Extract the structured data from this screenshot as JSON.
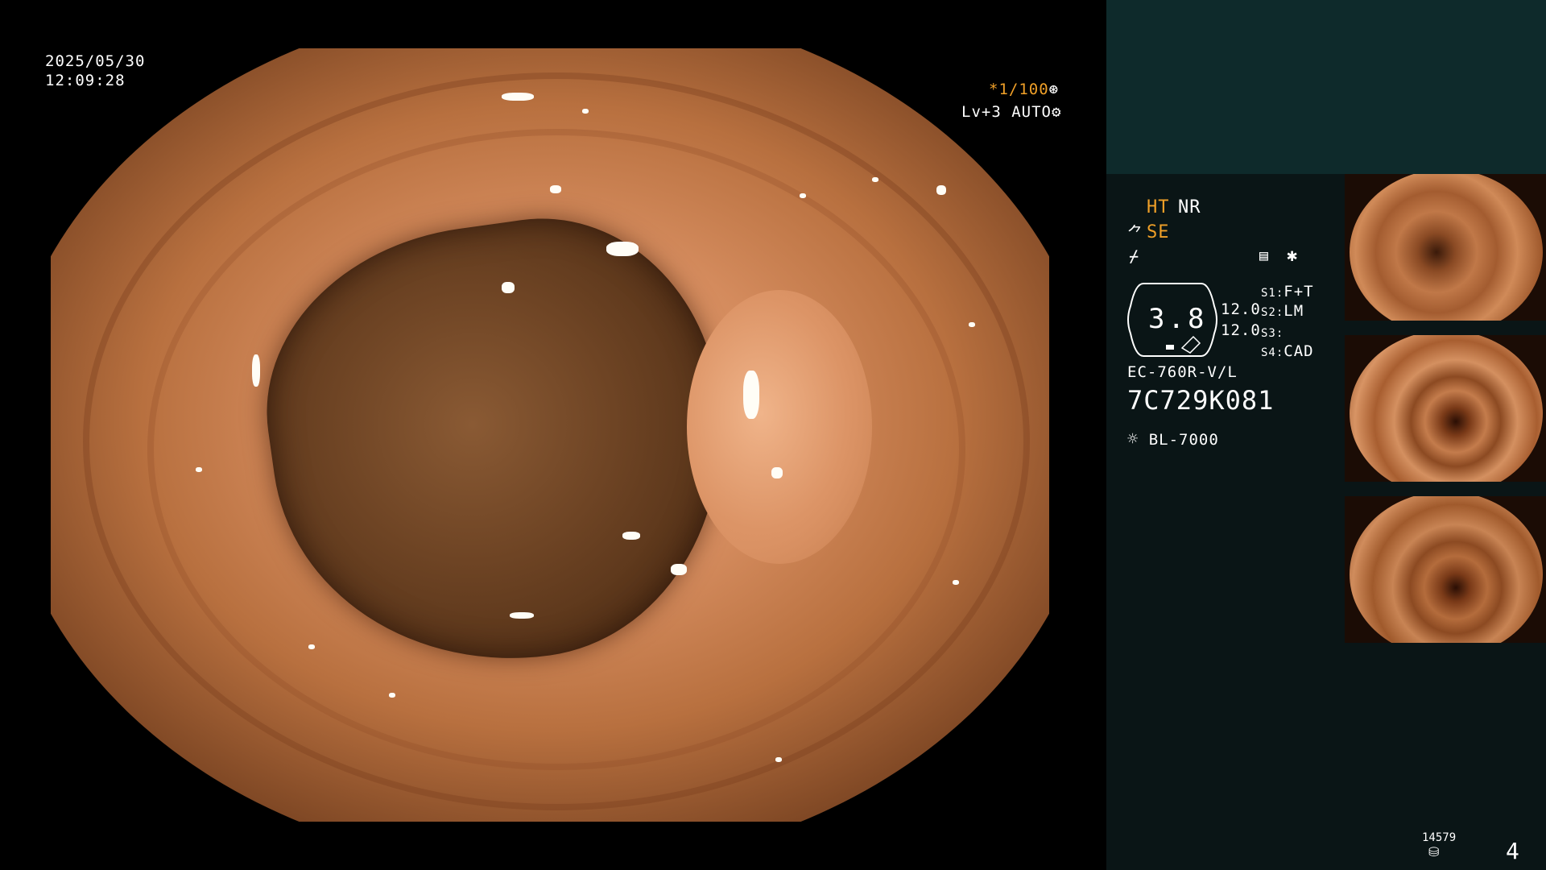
{
  "overlay": {
    "date": "2025/05/30",
    "time": "12:09:28",
    "shutter": "*1/100",
    "level": "Lv+3",
    "mode": "AUTO"
  },
  "settings": {
    "ht": "HT",
    "nr": "NR",
    "se": "SE",
    "gauge_value": "3.8",
    "val1": "12.0",
    "val2": "12.0",
    "s1_label": "S1:",
    "s1_value": "F+T",
    "s2_label": "S2:",
    "s2_value": "LM",
    "s3_label": "S3:",
    "s3_value": "",
    "s4_label": "S4:",
    "s4_value": "CAD",
    "scope_model": "EC-760R-V/L",
    "serial": "7C729K081",
    "light_source": "BL-7000"
  },
  "footer": {
    "count": "14579",
    "page": "4"
  },
  "icons": {
    "aperture": "aperture-icon",
    "gear": "gear-icon",
    "memory": "memory-icon",
    "asterisk": "asterisk-icon",
    "light": "light-source-icon",
    "disk": "disk-icon"
  },
  "colors": {
    "accent": "#f0a028",
    "panel": "#0a1516",
    "panel_top": "#0e2a2b"
  }
}
